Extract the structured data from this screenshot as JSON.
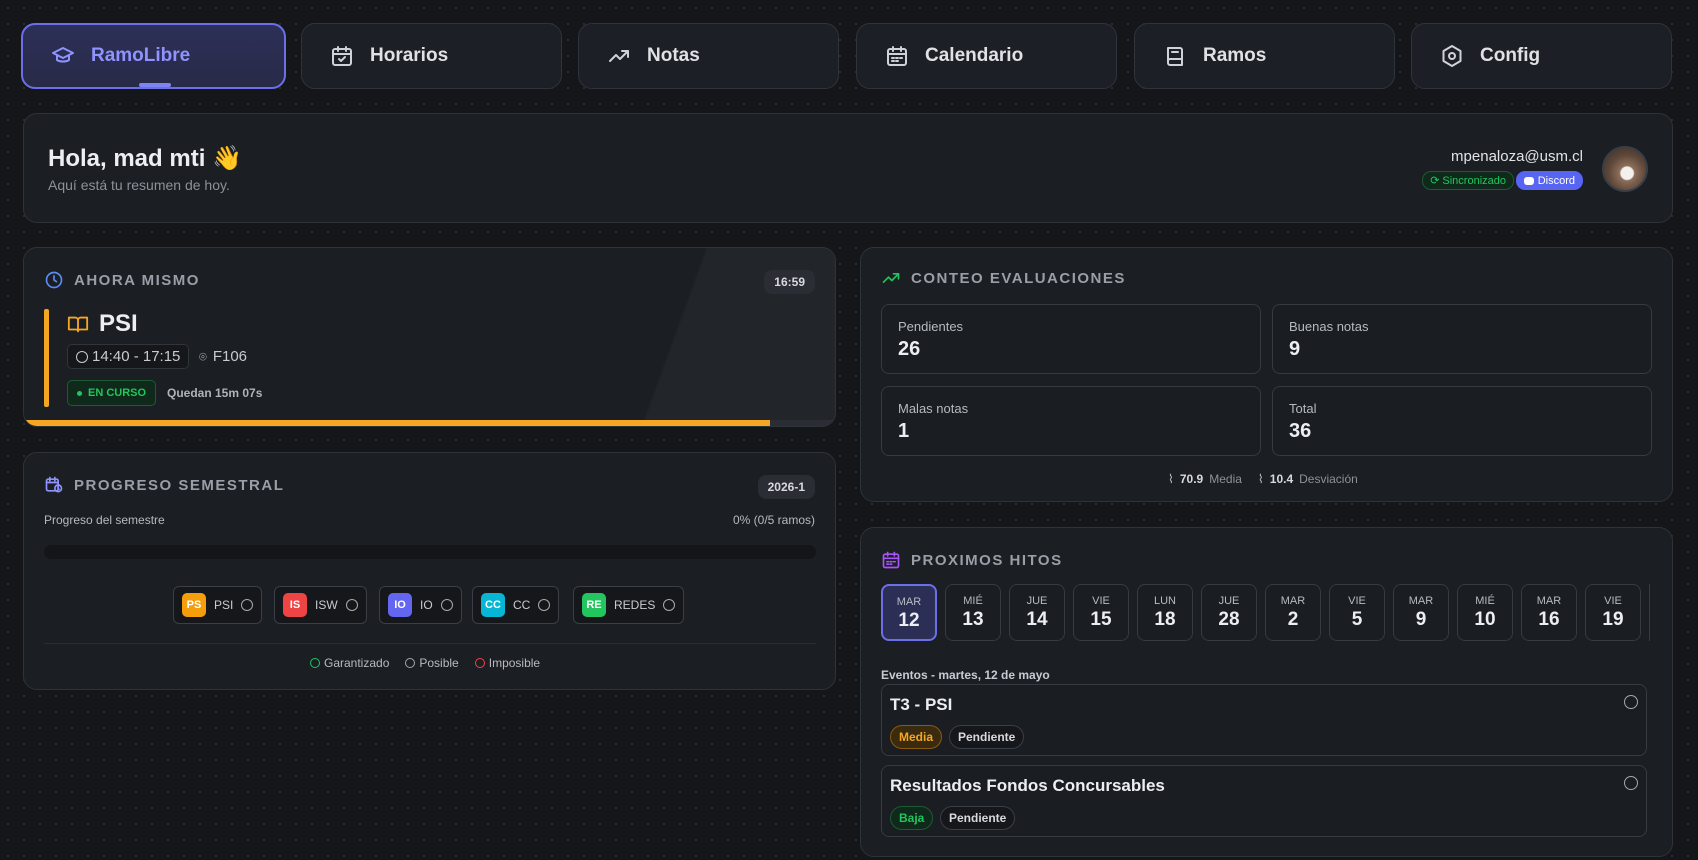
{
  "nav": {
    "items": [
      {
        "label": "RamoLibre",
        "icon": "graduation-cap-icon"
      },
      {
        "label": "Horarios",
        "icon": "calendar-check-icon"
      },
      {
        "label": "Notas",
        "icon": "trending-up-icon"
      },
      {
        "label": "Calendario",
        "icon": "calendar-icon"
      },
      {
        "label": "Ramos",
        "icon": "book-icon"
      },
      {
        "label": "Config",
        "icon": "settings-hexagon-icon"
      }
    ],
    "accent": "#8f93ff"
  },
  "header": {
    "greeting": "Hola, mad mti 👋",
    "subtitle": "Aquí está tu resumen de hoy.",
    "email": "mpenaloza@usm.cl",
    "sync_badge": "Sincronizado",
    "discord_badge": "Discord"
  },
  "now": {
    "title": "AHORA MISMO",
    "time": "16:59",
    "course": "PSI",
    "schedule": "14:40 - 17:15",
    "room": "F106",
    "status": "EN CURSO",
    "remaining": "Quedan 15m 07s",
    "progress": 0.92,
    "accent": "#f5a623"
  },
  "semester": {
    "title": "PROGRESO SEMESTRAL",
    "term": "2026-1",
    "label": "Progreso del semestre",
    "value": "0% (0/5 ramos)",
    "courses": [
      {
        "abbr": "PS",
        "name": "PSI",
        "color": "#f59e0b"
      },
      {
        "abbr": "IS",
        "name": "ISW",
        "color": "#ef4444"
      },
      {
        "abbr": "IO",
        "name": "IO",
        "color": "#6366f1"
      },
      {
        "abbr": "CC",
        "name": "CC",
        "color": "#06b6d4"
      },
      {
        "abbr": "RE",
        "name": "REDES",
        "color": "#22c55e"
      }
    ],
    "legend": {
      "guaranteed": "Garantizado",
      "possible": "Posible",
      "impossible": "Imposible"
    }
  },
  "evals": {
    "title": "CONTEO EVALUACIONES",
    "pending_label": "Pendientes",
    "pending": "26",
    "good_label": "Buenas notas",
    "good": "9",
    "bad_label": "Malas notas",
    "bad": "1",
    "total_label": "Total",
    "total": "36",
    "mean": "70.9",
    "mean_label": "Media",
    "std": "10.4",
    "std_label": "Desviación"
  },
  "milestones": {
    "title": "PROXIMOS HITOS",
    "days": [
      {
        "name": "MAR",
        "num": "12"
      },
      {
        "name": "MIÉ",
        "num": "13"
      },
      {
        "name": "JUE",
        "num": "14"
      },
      {
        "name": "VIE",
        "num": "15"
      },
      {
        "name": "LUN",
        "num": "18"
      },
      {
        "name": "JUE",
        "num": "28"
      },
      {
        "name": "MAR",
        "num": "2"
      },
      {
        "name": "VIE",
        "num": "5"
      },
      {
        "name": "MAR",
        "num": "9"
      },
      {
        "name": "MIÉ",
        "num": "10"
      },
      {
        "name": "MAR",
        "num": "16"
      },
      {
        "name": "VIE",
        "num": "19"
      }
    ],
    "events_header": "Eventos - martes, 12 de mayo",
    "events": [
      {
        "title": "T3 - PSI",
        "priority": "Media",
        "status": "Pendiente"
      },
      {
        "title": "Resultados Fondos Concursables",
        "priority": "Baja",
        "status": "Pendiente"
      }
    ]
  }
}
